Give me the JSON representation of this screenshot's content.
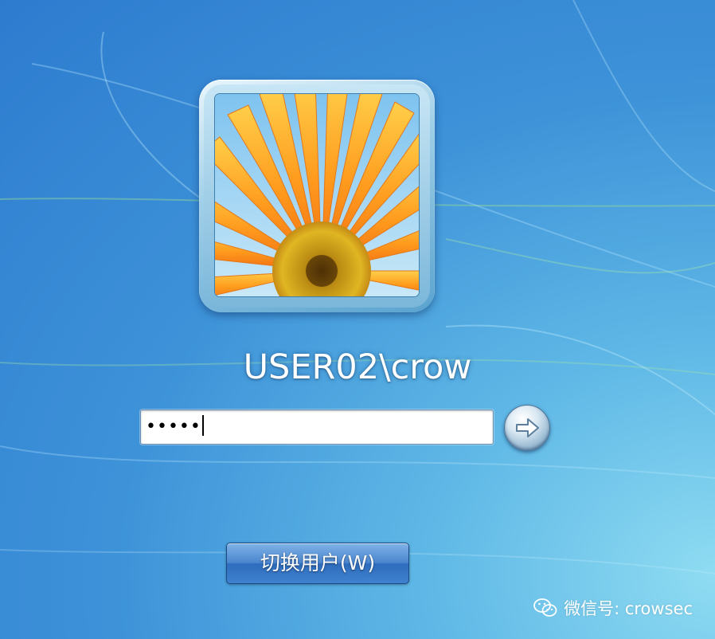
{
  "user": {
    "display_name": "USER02\\crow",
    "avatar_icon": "orange-flower-avatar"
  },
  "password": {
    "masked_value": "•••••",
    "submit_icon": "arrow-right-icon"
  },
  "actions": {
    "switch_user_label": "切换用户(W)"
  },
  "watermark": {
    "icon": "wechat-icon",
    "text": "微信号: crowsec"
  },
  "colors": {
    "background": "#3d92d8",
    "button": "#3f82d0"
  }
}
